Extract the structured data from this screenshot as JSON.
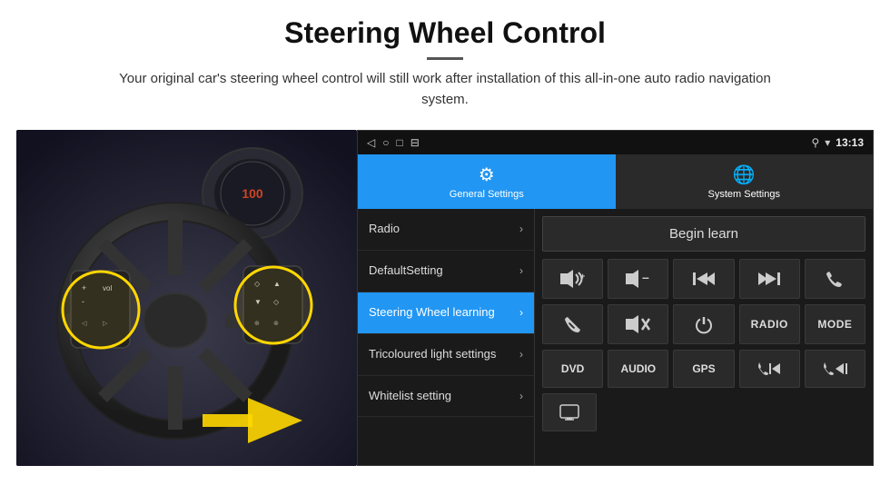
{
  "header": {
    "title": "Steering Wheel Control",
    "subtitle": "Your original car's steering wheel control will still work after installation of this all-in-one auto radio navigation system."
  },
  "status_bar": {
    "time": "13:13",
    "icons": [
      "◁",
      "○",
      "□",
      "⬛"
    ]
  },
  "tabs": [
    {
      "id": "general",
      "label": "General Settings",
      "active": true
    },
    {
      "id": "system",
      "label": "System Settings",
      "active": false
    }
  ],
  "menu": {
    "items": [
      {
        "id": "radio",
        "label": "Radio",
        "active": false
      },
      {
        "id": "default",
        "label": "DefaultSetting",
        "active": false
      },
      {
        "id": "steering",
        "label": "Steering Wheel learning",
        "active": true
      },
      {
        "id": "tricoloured",
        "label": "Tricoloured light settings",
        "active": false
      },
      {
        "id": "whitelist",
        "label": "Whitelist setting",
        "active": false
      }
    ]
  },
  "controls": {
    "begin_learn": "Begin learn",
    "row1": [
      {
        "id": "vol-up",
        "symbol": "🔊+",
        "type": "icon"
      },
      {
        "id": "vol-down",
        "symbol": "🔇-",
        "type": "icon"
      },
      {
        "id": "prev-track",
        "symbol": "⏮",
        "type": "icon"
      },
      {
        "id": "next-track",
        "symbol": "⏭",
        "type": "icon"
      },
      {
        "id": "phone",
        "symbol": "📞",
        "type": "icon"
      }
    ],
    "row2": [
      {
        "id": "hang-up",
        "symbol": "📵",
        "type": "icon"
      },
      {
        "id": "mute",
        "symbol": "🔇×",
        "type": "icon"
      },
      {
        "id": "power",
        "symbol": "⏻",
        "type": "icon"
      },
      {
        "id": "radio-btn",
        "symbol": "RADIO",
        "type": "text"
      },
      {
        "id": "mode-btn",
        "symbol": "MODE",
        "type": "text"
      }
    ],
    "row3": [
      {
        "id": "dvd-btn",
        "symbol": "DVD",
        "type": "text"
      },
      {
        "id": "audio-btn",
        "symbol": "AUDIO",
        "type": "text"
      },
      {
        "id": "gps-btn",
        "symbol": "GPS",
        "type": "text"
      },
      {
        "id": "tel-prev",
        "symbol": "📞⏮",
        "type": "icon"
      },
      {
        "id": "tel-next",
        "symbol": "📞⏭",
        "type": "icon"
      }
    ],
    "row4_icon": {
      "id": "extra",
      "symbol": "🖥",
      "type": "icon"
    }
  }
}
